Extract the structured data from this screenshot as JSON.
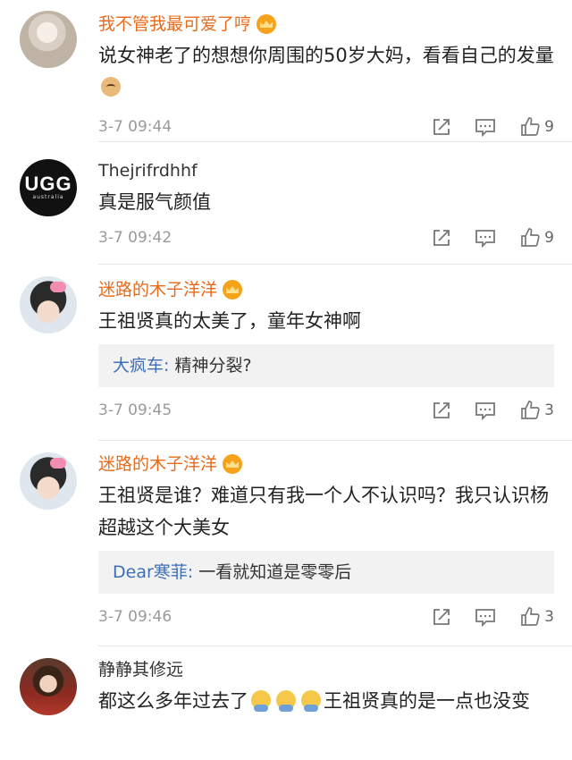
{
  "comments": [
    {
      "name": "我不管我最可爱了哼",
      "vip": true,
      "text": "说女神老了的想想你周围的50岁大妈，看看自己的发量",
      "emoji": "doge-emoji",
      "time": "3-7 09:44",
      "likes": "9"
    },
    {
      "name": "Thejrifrdhhf",
      "vip": false,
      "text": "真是服气颜值",
      "avatar_text": "UGG",
      "avatar_sub": "australia",
      "time": "3-7 09:42",
      "likes": "9"
    },
    {
      "name": "迷路的木子洋洋",
      "vip": true,
      "text": "王祖贤真的太美了，童年女神啊",
      "reply": {
        "user": "大疯车",
        "sep": ": ",
        "text": "精神分裂?"
      },
      "time": "3-7 09:45",
      "likes": "3"
    },
    {
      "name": "迷路的木子洋洋",
      "vip": true,
      "text": "王祖贤是谁？难道只有我一个人不认识吗？我只认识杨超越这个大美女",
      "reply": {
        "user": "Dear寒菲",
        "sep": ": ",
        "text": "一看就知道是零零后"
      },
      "time": "3-7 09:46",
      "likes": "3"
    },
    {
      "name": "静静其修远",
      "vip": false,
      "text_before": "都这么多年过去了",
      "emoji": "sweat-emoji",
      "text_after": "王祖贤真的是一点也没变"
    }
  ],
  "icons": {
    "share": "share-icon",
    "comment": "comment-icon",
    "like": "thumbs-up-icon",
    "vip": "crown-badge-icon"
  },
  "colors": {
    "vip_name": "#e86b1c",
    "reply_user": "#3f6fb6",
    "meta": "#9a9a9a",
    "reply_bg": "#f2f2f2"
  }
}
